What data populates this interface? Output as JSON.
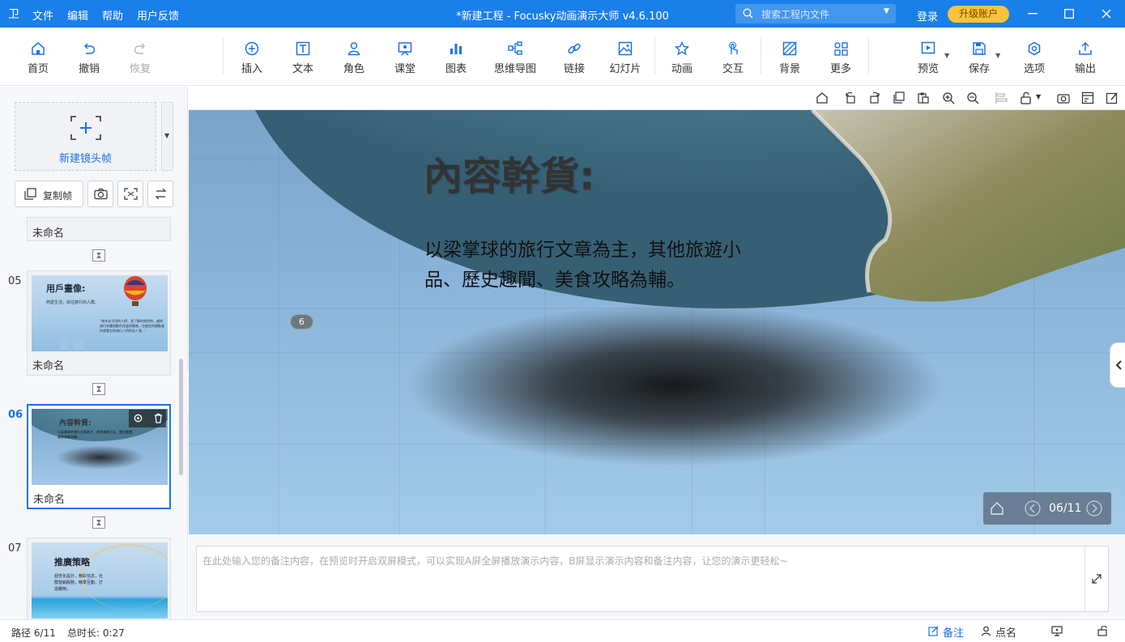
{
  "titlebar": {
    "logo": "卫",
    "menus": [
      "文件",
      "编辑",
      "帮助",
      "用户反馈"
    ],
    "title": "*新建工程 - Focusky动画演示大师  v4.6.100",
    "search_placeholder": "搜索工程内文件",
    "login": "登录",
    "upgrade": "升级账户"
  },
  "toolbar": {
    "home": "首页",
    "undo": "撤销",
    "redo": "恢复",
    "insert": "插入",
    "text": "文本",
    "role": "角色",
    "classroom": "课堂",
    "chart": "图表",
    "mindmap": "思维导图",
    "link": "链接",
    "slideshow": "幻灯片",
    "animation": "动画",
    "interaction": "交互",
    "background": "背景",
    "more": "更多",
    "preview": "预览",
    "save": "保存",
    "options": "选项",
    "export": "输出"
  },
  "leftpanel": {
    "new_frame": "新建镜头帧",
    "copy_frame": "复制帧",
    "slides": [
      {
        "num": "",
        "name": "未命名"
      },
      {
        "num": "05",
        "name": "未命名",
        "thumb_title": "用戶畫像:",
        "thumb_line": "熱愛生活，尚往旅行的人群。",
        "thumb_quote": "“每年去不同的人們，到了解的他們的，越知旅行有種寫數的深度與情感，在能信的讀點後你就看它的旅行人們的名人我…”"
      },
      {
        "num": "06",
        "name": "未命名",
        "active": true,
        "thumb_title": "內容幹貨:",
        "thumb_line": "以梁掌球的旅行文章為主，其他旅遊小品、歷史趣聞、美食攻略為輔。"
      },
      {
        "num": "07",
        "name": "",
        "thumb_title": "推廣策略",
        "thumb_line": "個性化設計，精彩信息，社群營銷服務，精準互動，打造獨特。"
      }
    ]
  },
  "slide": {
    "title": "內容幹貨:",
    "body_line1": "以梁掌球的旅行文章為主，其他旅遊小",
    "body_line2": "品、歷史趣聞、美食攻略為輔。",
    "frame_badge": "6",
    "pager": "06/11"
  },
  "notes": {
    "placeholder": "在此处输入您的备注内容，在预览时开启双屏模式，可以实现A屏全屏播放演示内容，B屏显示演示内容和备注内容，让您的演示更轻松~"
  },
  "statusbar": {
    "path": "路径 6/11",
    "duration": "总时长: 0:27",
    "notes": "备注",
    "rollcall": "点名"
  }
}
